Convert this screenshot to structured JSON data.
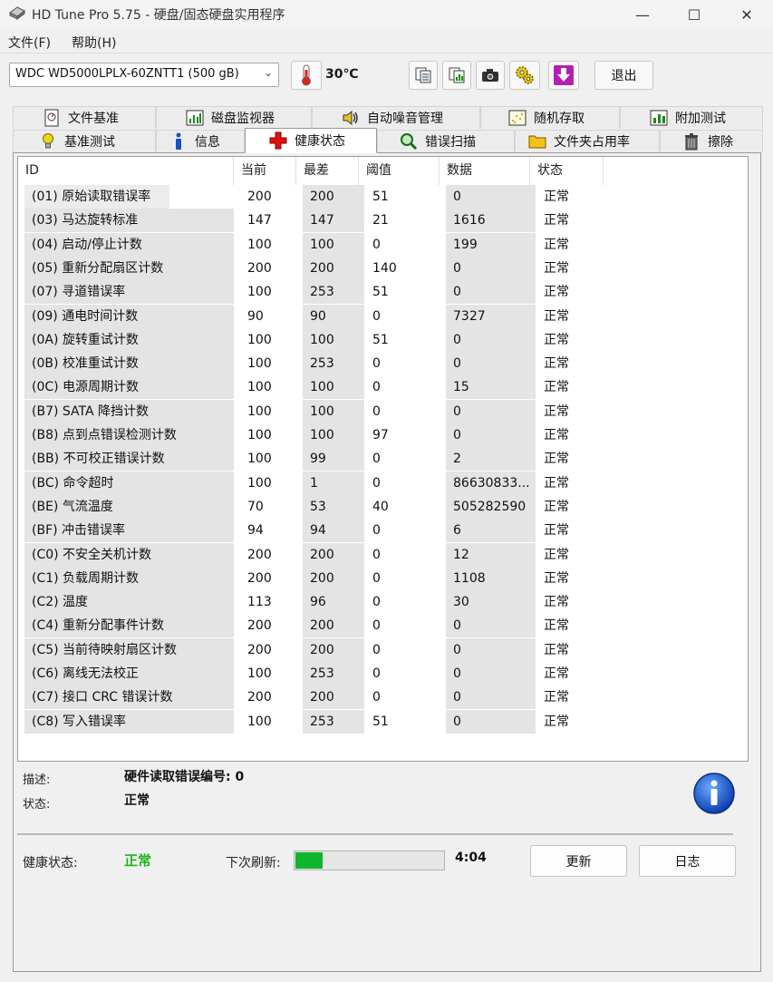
{
  "window": {
    "title": "HD Tune Pro 5.75 - 硬盘/固态硬盘实用程序",
    "minimize": "—",
    "maximize": "☐",
    "close": "✕"
  },
  "menu": {
    "file": "文件(F)",
    "help": "帮助(H)"
  },
  "toolbar": {
    "drive": "WDC WD5000LPLX-60ZNTT1 (500 gB)",
    "temperature": "30℃",
    "exit": "退出"
  },
  "tabs": [
    {
      "label": "文件基准",
      "icon": "file-benchmark-icon"
    },
    {
      "label": "磁盘监视器",
      "icon": "disk-monitor-icon"
    },
    {
      "label": "自动噪音管理",
      "icon": "speaker-icon"
    },
    {
      "label": "随机存取",
      "icon": "random-access-icon"
    },
    {
      "label": "附加测试",
      "icon": "extra-tests-icon"
    },
    {
      "label": "基准测试",
      "icon": "benchmark-icon"
    },
    {
      "label": "信息",
      "icon": "info-icon"
    },
    {
      "label": "健康状态",
      "icon": "health-icon"
    },
    {
      "label": "错误扫描",
      "icon": "magnifier-icon"
    },
    {
      "label": "文件夹占用率",
      "icon": "folder-icon"
    },
    {
      "label": "擦除",
      "icon": "trash-icon"
    }
  ],
  "table": {
    "headers": [
      "ID",
      "当前",
      "最差",
      "阈值",
      "数据",
      "状态"
    ],
    "rows": [
      [
        "(01) 原始读取错误率",
        "200",
        "200",
        "51",
        "0",
        "正常"
      ],
      [
        "(03) 马达旋转标准",
        "147",
        "147",
        "21",
        "1616",
        "正常"
      ],
      [
        "(04) 启动/停止计数",
        "100",
        "100",
        "0",
        "199",
        "正常"
      ],
      [
        "(05) 重新分配扇区计数",
        "200",
        "200",
        "140",
        "0",
        "正常"
      ],
      [
        "(07) 寻道错误率",
        "100",
        "253",
        "51",
        "0",
        "正常"
      ],
      [
        "(09) 通电时间计数",
        "90",
        "90",
        "0",
        "7327",
        "正常"
      ],
      [
        "(0A) 旋转重试计数",
        "100",
        "100",
        "51",
        "0",
        "正常"
      ],
      [
        "(0B) 校准重试计数",
        "100",
        "253",
        "0",
        "0",
        "正常"
      ],
      [
        "(0C) 电源周期计数",
        "100",
        "100",
        "0",
        "15",
        "正常"
      ],
      [
        "(B7) SATA 降挡计数",
        "100",
        "100",
        "0",
        "0",
        "正常"
      ],
      [
        "(B8) 点到点错误检测计数",
        "100",
        "100",
        "97",
        "0",
        "正常"
      ],
      [
        "(BB) 不可校正错误计数",
        "100",
        "99",
        "0",
        "2",
        "正常"
      ],
      [
        "(BC) 命令超时",
        "100",
        "1",
        "0",
        "86630833...",
        "正常"
      ],
      [
        "(BE) 气流温度",
        "70",
        "53",
        "40",
        "505282590",
        "正常"
      ],
      [
        "(BF) 冲击错误率",
        "94",
        "94",
        "0",
        "6",
        "正常"
      ],
      [
        "(C0) 不安全关机计数",
        "200",
        "200",
        "0",
        "12",
        "正常"
      ],
      [
        "(C1) 负载周期计数",
        "200",
        "200",
        "0",
        "1108",
        "正常"
      ],
      [
        "(C2) 温度",
        "113",
        "96",
        "0",
        "30",
        "正常"
      ],
      [
        "(C4) 重新分配事件计数",
        "200",
        "200",
        "0",
        "0",
        "正常"
      ],
      [
        "(C5) 当前待映射扇区计数",
        "200",
        "200",
        "0",
        "0",
        "正常"
      ],
      [
        "(C6) 离线无法校正",
        "100",
        "253",
        "0",
        "0",
        "正常"
      ],
      [
        "(C7) 接口 CRC 错误计数",
        "200",
        "200",
        "0",
        "0",
        "正常"
      ],
      [
        "(C8) 写入错误率",
        "100",
        "253",
        "51",
        "0",
        "正常"
      ]
    ]
  },
  "details": {
    "desc_label": "描述:",
    "desc_value": "硬件读取错误编号: 0",
    "state_label": "状态:",
    "state_value": "正常"
  },
  "footer": {
    "health_label": "健康状态:",
    "health_value": "正常",
    "refresh_label": "下次刷新:",
    "refresh_progress": 0.18,
    "countdown": "4:04",
    "update": "更新",
    "log": "日志"
  },
  "colors": {
    "progress": "#0fb52c",
    "health_ok": "#1eb51e"
  }
}
